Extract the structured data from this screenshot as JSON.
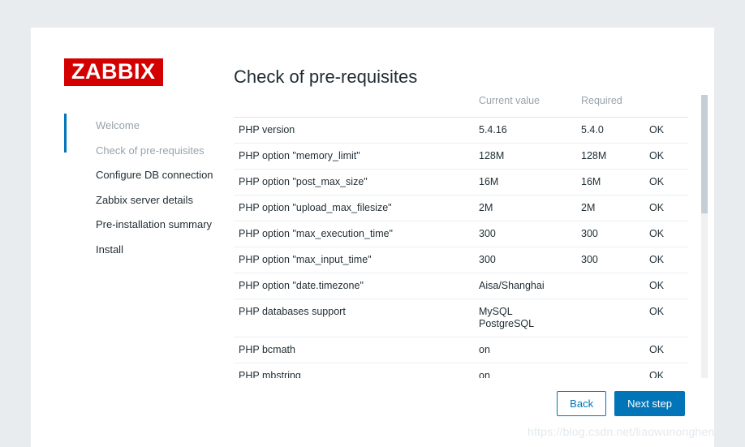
{
  "brand": {
    "logo_text": "ZABBIX",
    "logo_bg_color": "#d40000",
    "accent_color": "#0275b8"
  },
  "sidebar": {
    "steps": [
      {
        "label": "Welcome",
        "state": "done"
      },
      {
        "label": "Check of pre-requisites",
        "state": "done"
      },
      {
        "label": "Configure DB connection",
        "state": "upcoming"
      },
      {
        "label": "Zabbix server details",
        "state": "upcoming"
      },
      {
        "label": "Pre-installation summary",
        "state": "upcoming"
      },
      {
        "label": "Install",
        "state": "upcoming"
      }
    ]
  },
  "main": {
    "title": "Check of pre-requisites",
    "table": {
      "headers": [
        "",
        "Current value",
        "Required",
        ""
      ],
      "rows": [
        {
          "name": "PHP version",
          "current": "5.4.16",
          "required": "5.4.0",
          "status": "OK"
        },
        {
          "name": "PHP option \"memory_limit\"",
          "current": "128M",
          "required": "128M",
          "status": "OK"
        },
        {
          "name": "PHP option \"post_max_size\"",
          "current": "16M",
          "required": "16M",
          "status": "OK"
        },
        {
          "name": "PHP option \"upload_max_filesize\"",
          "current": "2M",
          "required": "2M",
          "status": "OK"
        },
        {
          "name": "PHP option \"max_execution_time\"",
          "current": "300",
          "required": "300",
          "status": "OK"
        },
        {
          "name": "PHP option \"max_input_time\"",
          "current": "300",
          "required": "300",
          "status": "OK"
        },
        {
          "name": "PHP option \"date.timezone\"",
          "current": "Aisa/Shanghai",
          "required": "",
          "status": "OK"
        },
        {
          "name": "PHP databases support",
          "current": "MySQL\nPostgreSQL",
          "required": "",
          "status": "OK"
        },
        {
          "name": "PHP bcmath",
          "current": "on",
          "required": "",
          "status": "OK"
        },
        {
          "name": "PHP mbstring",
          "current": "on",
          "required": "",
          "status": "OK"
        }
      ]
    },
    "status_ok_color": "#3d8b3d"
  },
  "footer": {
    "back_label": "Back",
    "next_label": "Next step"
  },
  "watermark": {
    "text": "https://blog.csdn.net/liaowunonghen"
  }
}
